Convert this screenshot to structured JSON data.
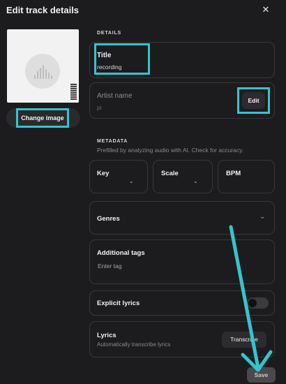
{
  "header": {
    "title": "Edit track details",
    "close_glyph": "✕"
  },
  "cover": {
    "change_label": "Change image",
    "waveform_icon": "waveform-icon"
  },
  "details": {
    "section_label": "DETAILS",
    "title_label": "Title",
    "title_value": "recording",
    "artist_label": "Artist name",
    "artist_value": "pi",
    "edit_label": "Edit"
  },
  "metadata": {
    "section_label": "METADATA",
    "hint": "Prefilled by analyzing audio with AI. Check for accuracy.",
    "key_label": "Key",
    "scale_label": "Scale",
    "bpm_label": "BPM",
    "chevron_glyph": "⌄"
  },
  "genres": {
    "label": "Genres",
    "chevron_glyph": "⌄"
  },
  "tags": {
    "label": "Additional tags",
    "placeholder": "Enter tag"
  },
  "explicit": {
    "label": "Explicit lyrics",
    "on": false
  },
  "lyrics": {
    "label": "Lyrics",
    "sub": "Automatically transcribe lyrics",
    "transcribe_label": "Transcribe"
  },
  "footer": {
    "save_label": "Save"
  },
  "colors": {
    "background": "#1c1c1e",
    "highlight": "#35c4cf",
    "card_border": "#38383b"
  }
}
